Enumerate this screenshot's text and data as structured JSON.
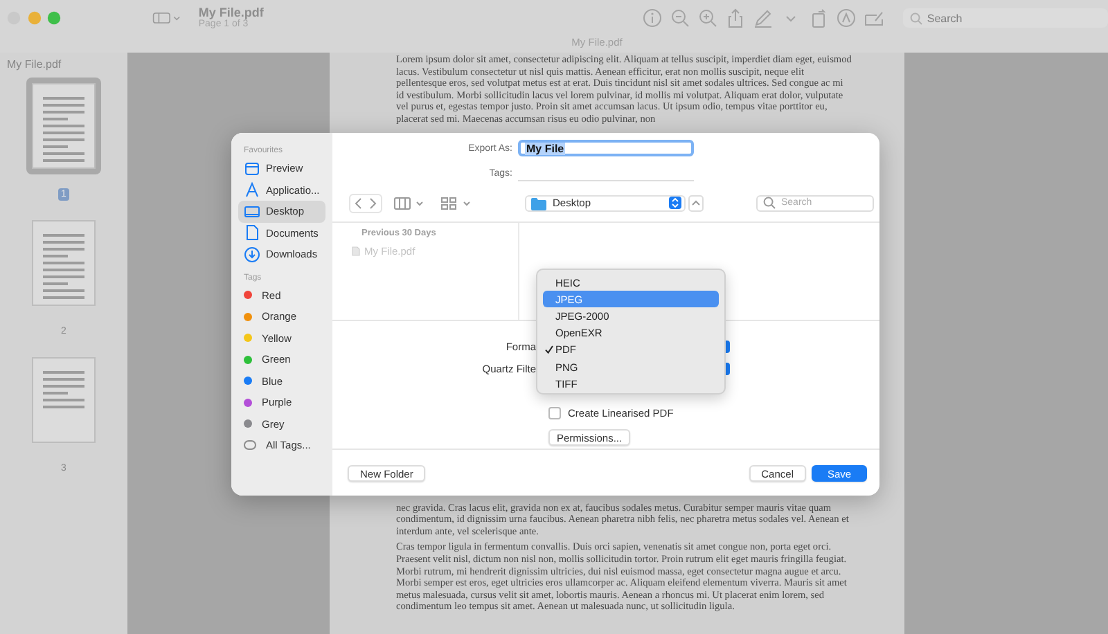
{
  "window": {
    "title": "My File.pdf",
    "subtitle": "Page 1 of 3",
    "tab_title": "My File.pdf",
    "search": {
      "placeholder": "Search"
    }
  },
  "sidebar": {
    "title": "My File.pdf",
    "pages": [
      {
        "label": "1",
        "selected": true
      },
      {
        "label": "2",
        "selected": false
      },
      {
        "label": "3",
        "selected": false
      }
    ]
  },
  "document": {
    "paragraphs_top": [
      "Lorem ipsum dolor sit amet, consectetur adipiscing elit. Aliquam at tellus suscipit, imperdiet diam eget, euismod lacus. Vestibulum consectetur ut nisl quis mattis. Aenean efficitur, erat non mollis suscipit, neque elit pellentesque eros, sed volutpat metus est at erat. Duis tincidunt nisl sit amet sodales ultrices. Sed congue ac mi id vestibulum. Morbi sollicitudin lacus vel lorem pulvinar, id mollis mi volutpat. Aliquam erat dolor, vulputate vel purus et, egestas tempor justo. Proin sit amet accumsan lacus. Ut ipsum odio, tempus vitae porttitor eu, placerat sed mi. Maecenas accumsan risus eu odio pulvinar, non"
    ],
    "paragraphs_bottom": [
      "nec gravida. Cras lacus elit, gravida non ex at, faucibus sodales metus. Curabitur semper mauris vitae quam condimentum, id dignissim urna faucibus. Aenean pharetra nibh felis, nec pharetra metus sodales vel. Aenean et interdum ante, vel scelerisque ante.",
      "Cras tempor ligula in fermentum convallis. Duis orci sapien, venenatis sit amet congue non, porta eget orci. Praesent velit nisl, dictum non nisl non, mollis sollicitudin tortor. Proin rutrum elit eget mauris fringilla feugiat. Morbi rutrum, mi hendrerit dignissim ultricies, dui nisl euismod massa, eget consectetur magna augue et arcu. Morbi semper est eros, eget ultricies eros ullamcorper ac. Aliquam eleifend elementum viverra. Mauris sit amet metus malesuada, cursus velit sit amet, lobortis mauris. Aenean a rhoncus mi. Ut placerat enim lorem, sed condimentum leo tempus sit amet. Aenean ut malesuada nunc, ut sollicitudin ligula."
    ]
  },
  "export_dialog": {
    "sidebar": {
      "favourites_heading": "Favourites",
      "favourites": [
        {
          "label": "Preview",
          "selected": false
        },
        {
          "label": "Applicatio...",
          "selected": false
        },
        {
          "label": "Desktop",
          "selected": true
        },
        {
          "label": "Documents",
          "selected": false
        },
        {
          "label": "Downloads",
          "selected": false
        }
      ],
      "tags_heading": "Tags",
      "tags": [
        {
          "kind": "tag",
          "label": "Red",
          "color": "#f0443a"
        },
        {
          "kind": "tag",
          "label": "Orange",
          "color": "#f0900c"
        },
        {
          "kind": "tag",
          "label": "Yellow",
          "color": "#f4c619"
        },
        {
          "kind": "tag",
          "label": "Green",
          "color": "#2dc03a"
        },
        {
          "kind": "tag",
          "label": "Blue",
          "color": "#1a7cf5"
        },
        {
          "kind": "tag",
          "label": "Purple",
          "color": "#b34fd8"
        },
        {
          "kind": "tag",
          "label": "Grey",
          "color": "#8a8a8e"
        },
        {
          "kind": "all",
          "label": "All Tags..."
        }
      ]
    },
    "export_as": {
      "label": "Export As:",
      "value": "My File"
    },
    "tags_field": {
      "label": "Tags:"
    },
    "location": {
      "value": "Desktop"
    },
    "search": {
      "placeholder": "Search"
    },
    "file_list": {
      "group": "Previous 30 Days",
      "files": [
        {
          "name": "My File.pdf",
          "disabled": true
        }
      ]
    },
    "format": {
      "label": "Forma"
    },
    "quartz_filter": {
      "label": "Quartz Filte"
    },
    "format_menu": [
      {
        "label": "HEIC",
        "highlighted": false,
        "checked": false
      },
      {
        "label": "JPEG",
        "highlighted": true,
        "checked": false
      },
      {
        "label": "JPEG-2000",
        "highlighted": false,
        "checked": false
      },
      {
        "label": "OpenEXR",
        "highlighted": false,
        "checked": false
      },
      {
        "label": "PDF",
        "highlighted": false,
        "checked": true
      },
      {
        "label": "PNG",
        "highlighted": false,
        "checked": false
      },
      {
        "label": "TIFF",
        "highlighted": false,
        "checked": false
      }
    ],
    "linearised": {
      "label": "Create Linearised PDF",
      "checked": false
    },
    "buttons": {
      "permissions": "Permissions...",
      "new_folder": "New Folder",
      "cancel": "Cancel",
      "save": "Save"
    }
  }
}
